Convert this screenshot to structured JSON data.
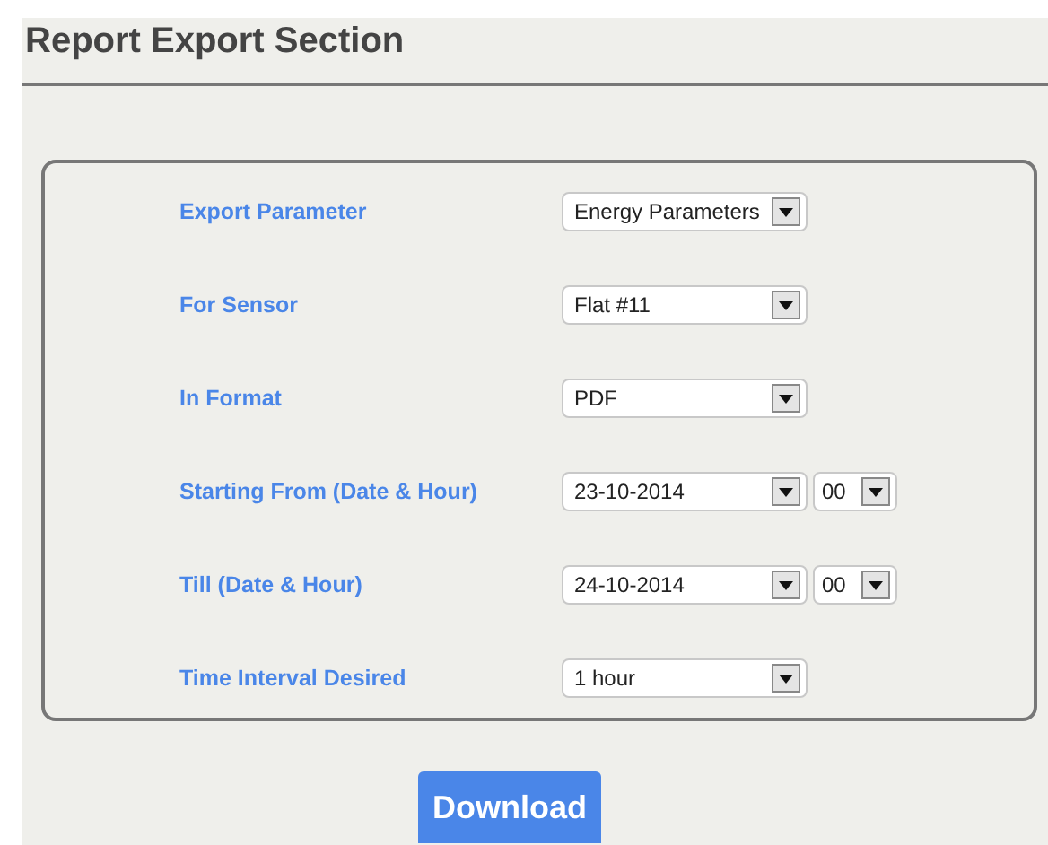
{
  "title": "Report Export Section",
  "rows": [
    {
      "kind": "select",
      "label": "Export Parameter",
      "value": "Energy Parameters"
    },
    {
      "kind": "select",
      "label": "For Sensor",
      "value": "Flat #11"
    },
    {
      "kind": "select",
      "label": "In Format",
      "value": "PDF"
    },
    {
      "kind": "datetime",
      "label": "Starting From (Date & Hour)",
      "value": "23-10-2014",
      "hour": "00"
    },
    {
      "kind": "datetime",
      "label": "Till (Date & Hour)",
      "value": "24-10-2014",
      "hour": "00"
    },
    {
      "kind": "select",
      "label": "Time Interval Desired",
      "value": "1 hour"
    }
  ],
  "button": "Download"
}
